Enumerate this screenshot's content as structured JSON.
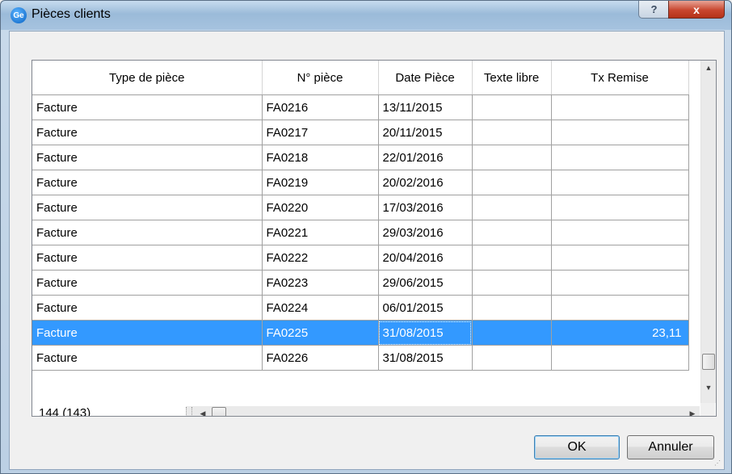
{
  "window": {
    "title": "Pièces clients",
    "app_icon_text": "Ge",
    "help_label": "?",
    "close_label": "x"
  },
  "grid": {
    "columns": [
      "Type de pièce",
      "N° pièce",
      "Date Pièce",
      "Texte libre",
      "Tx Remise"
    ],
    "rows": [
      {
        "type": "Facture",
        "num": "FA0216",
        "date": "13/11/2015",
        "texte": "",
        "remise": ""
      },
      {
        "type": "Facture",
        "num": "FA0217",
        "date": "20/11/2015",
        "texte": "",
        "remise": ""
      },
      {
        "type": "Facture",
        "num": "FA0218",
        "date": "22/01/2016",
        "texte": "",
        "remise": ""
      },
      {
        "type": "Facture",
        "num": "FA0219",
        "date": "20/02/2016",
        "texte": "",
        "remise": ""
      },
      {
        "type": "Facture",
        "num": "FA0220",
        "date": "17/03/2016",
        "texte": "",
        "remise": ""
      },
      {
        "type": "Facture",
        "num": "FA0221",
        "date": "29/03/2016",
        "texte": "",
        "remise": ""
      },
      {
        "type": "Facture",
        "num": "FA0222",
        "date": "20/04/2016",
        "texte": "",
        "remise": ""
      },
      {
        "type": "Facture",
        "num": "FA0223",
        "date": "29/06/2015",
        "texte": "",
        "remise": ""
      },
      {
        "type": "Facture",
        "num": "FA0224",
        "date": "06/01/2015",
        "texte": "",
        "remise": ""
      },
      {
        "type": "Facture",
        "num": "FA0225",
        "date": "31/08/2015",
        "texte": "",
        "remise": "23,11"
      },
      {
        "type": "Facture",
        "num": "FA0226",
        "date": "31/08/2015",
        "texte": "",
        "remise": ""
      }
    ],
    "selected_row_index": 9,
    "record_count": "144 (143)"
  },
  "buttons": {
    "ok": "OK",
    "cancel": "Annuler"
  },
  "colors": {
    "selection": "#3399ff",
    "title_bar": "#9bbbd9",
    "close_button": "#c8462f"
  },
  "icons": {
    "app": "ge-app-icon",
    "help": "help-icon",
    "close": "close-icon"
  }
}
